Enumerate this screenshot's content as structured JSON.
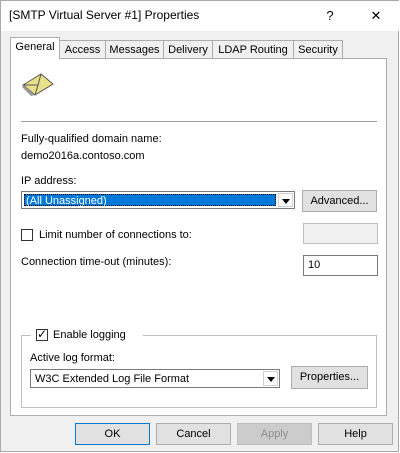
{
  "window": {
    "title": "[SMTP Virtual Server #1] Properties",
    "help_glyph": "?",
    "close_glyph": "✕"
  },
  "tabs": [
    {
      "label": "General",
      "active": true
    },
    {
      "label": "Access"
    },
    {
      "label": "Messages"
    },
    {
      "label": "Delivery"
    },
    {
      "label": "LDAP Routing"
    },
    {
      "label": "Security"
    }
  ],
  "general": {
    "server_icon": "smtp-envelope-icon",
    "fqdn_label": "Fully-qualified domain name:",
    "fqdn_value": "demo2016a.contoso.com",
    "ip_label": "IP address:",
    "ip_value": "(All Unassigned)",
    "advanced_button": "Advanced...",
    "limit_connections_label": "Limit number of connections to:",
    "limit_connections_checked": false,
    "limit_connections_value": "",
    "timeout_label": "Connection time-out (minutes):",
    "timeout_value": "10",
    "enable_logging_label": "Enable logging",
    "enable_logging_checked": true,
    "log_format_label": "Active log format:",
    "log_format_value": "W3C Extended Log File Format",
    "properties_button": "Properties..."
  },
  "buttons": {
    "ok": "OK",
    "cancel": "Cancel",
    "apply": "Apply",
    "help": "Help"
  },
  "colors": {
    "selection": "#0078d7",
    "dialog_bg": "#f0f0f0",
    "panel_bg": "#ffffff"
  }
}
